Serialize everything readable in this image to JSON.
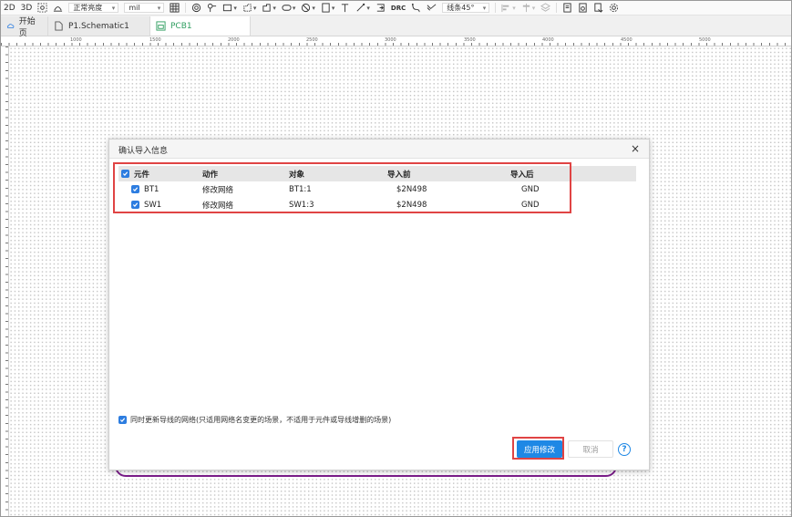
{
  "toolbar": {
    "view_2d": "2D",
    "view_3d": "3D",
    "brightness": "正常亮度",
    "unit": "mil",
    "drc_label": "DRC",
    "route_mode": "线条45°"
  },
  "tabs": [
    {
      "label": "开始页"
    },
    {
      "label": "P1.Schematic1"
    },
    {
      "label": "PCB1"
    }
  ],
  "ruler": {
    "marks": [
      "1000",
      "1500",
      "2000",
      "2500",
      "3000",
      "3500",
      "4000",
      "4500",
      "5000"
    ]
  },
  "dialog": {
    "title": "确认导入信息",
    "close": "×",
    "columns": [
      "元件",
      "动作",
      "对象",
      "导入前",
      "导入后"
    ],
    "rows": [
      {
        "component": "BT1",
        "action": "修改网络",
        "object": "BT1:1",
        "before": "$2N498",
        "after": "GND"
      },
      {
        "component": "SW1",
        "action": "修改网络",
        "object": "SW1:3",
        "before": "$2N498",
        "after": "GND"
      }
    ],
    "sync_label": "同时更新导线的网络(只适用网络名变更的场景，不适用于元件或导线增删的场景)",
    "apply": "应用修改",
    "cancel": "取消",
    "help": "?"
  },
  "colors": {
    "accent": "#1e88e5",
    "checkbox": "#2d7de0",
    "highlight_red": "#e04444",
    "board_outline": "#7b1d8a",
    "tab_active": "#2f9e60"
  }
}
